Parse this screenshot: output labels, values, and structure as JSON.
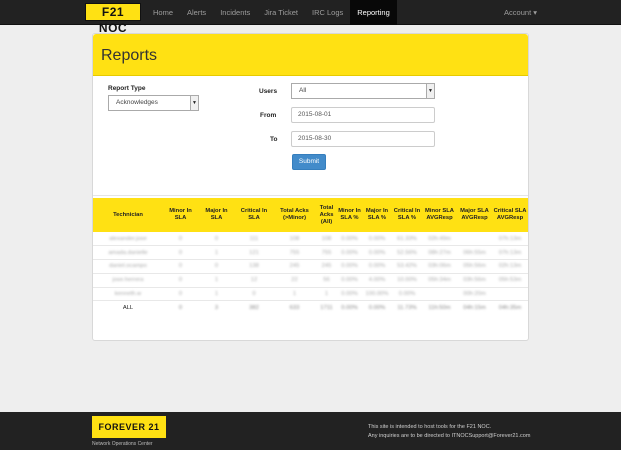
{
  "nav": {
    "brand": "F21 NOC",
    "items": [
      {
        "label": "Home",
        "active": false
      },
      {
        "label": "Alerts",
        "active": false
      },
      {
        "label": "Incidents",
        "active": false
      },
      {
        "label": "Jira Ticket",
        "active": false
      },
      {
        "label": "IRC Logs",
        "active": false
      },
      {
        "label": "Reporting",
        "active": true
      }
    ],
    "account": "Account ▾"
  },
  "reports": {
    "title": "Reports",
    "report_type_label": "Report Type",
    "report_type_value": "Acknowledges",
    "users_label": "Users",
    "users_value": "All",
    "from_label": "From",
    "from_value": "2015-08-01",
    "to_label": "To",
    "to_value": "2015-08-30",
    "submit": "Submit"
  },
  "table": {
    "headers": [
      "Technician",
      "Minor In SLA",
      "Major In SLA",
      "Critical In SLA",
      "Total Acks (>Minor)",
      "Total Acks (All)",
      "Minor In SLA %",
      "Major In SLA %",
      "Critical In SLA %",
      "Minor SLA AVGResp",
      "Major SLA AVGResp",
      "Critical SLA AVGResp"
    ],
    "rows": [
      [
        "alexander.jose",
        "0",
        "0",
        "111",
        "108",
        "108",
        "0.00%",
        "0.00%",
        "61.33%",
        "02h:49m",
        "",
        "07h:13m"
      ],
      [
        "amada.danielle",
        "0",
        "1",
        "121",
        "755",
        "755",
        "0.00%",
        "0.00%",
        "52.56%",
        "08h:27m",
        "06h:55m",
        "07h:13m"
      ],
      [
        "daniel.ocampo",
        "0",
        "0",
        "138",
        "245",
        "245",
        "0.00%",
        "0.00%",
        "53.42%",
        "03h:06m",
        "05h:56m",
        "02h:13m"
      ],
      [
        "jose.herrera",
        "0",
        "1",
        "12",
        "22",
        "56",
        "0.00%",
        "4.00%",
        "10.00%",
        "05h:34m",
        "03h:56m",
        "05h:53m"
      ],
      [
        "kenneth.w",
        "0",
        "1",
        "0",
        "1",
        "1",
        "0.00%",
        "100.00%",
        "0.00%",
        "",
        "00h:20m",
        ""
      ],
      [
        "ALL",
        "0",
        "3",
        "382",
        "633",
        "1711",
        "0.00%",
        "0.00%",
        "11.73%",
        "11h:50m",
        "04h:15m",
        "04h:35m"
      ]
    ]
  },
  "footer": {
    "logo": "FOREVER 21",
    "sub": "Network Operations Center",
    "line1": "This site is intended to host tools for the F21 NOC.",
    "line2": "Any inquiries are to be directed to ITNOCSupport@Forever21.com"
  }
}
